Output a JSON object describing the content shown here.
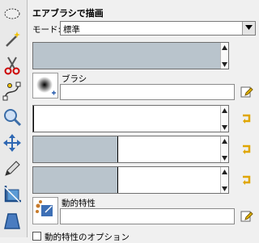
{
  "toolbox": {
    "tools": [
      {
        "name": "ellipse-select-icon"
      },
      {
        "name": "fuzzy-select-icon"
      },
      {
        "name": "scissors-select-icon"
      },
      {
        "name": "paths-icon"
      },
      {
        "name": "zoom-icon"
      },
      {
        "name": "move-icon"
      },
      {
        "name": "pencil-icon"
      },
      {
        "name": "crop-icon"
      },
      {
        "name": "perspective-icon"
      }
    ]
  },
  "panel": {
    "title": "エアブラシで描画",
    "mode_label": "モード:",
    "mode_value": "標準",
    "opacity_fill": 1.0,
    "brush_label": "ブラシ",
    "brush_value": "",
    "size_fill": 0.0,
    "aspect_fill": 0.49,
    "angle_fill": 0.49,
    "dynamics_label": "動的特性",
    "dynamics_value": "",
    "dynamics_options_label": "動的特性のオプション"
  },
  "colors": {
    "slider_fill": "#b9c4cc",
    "link_icon": "#e0a600"
  }
}
